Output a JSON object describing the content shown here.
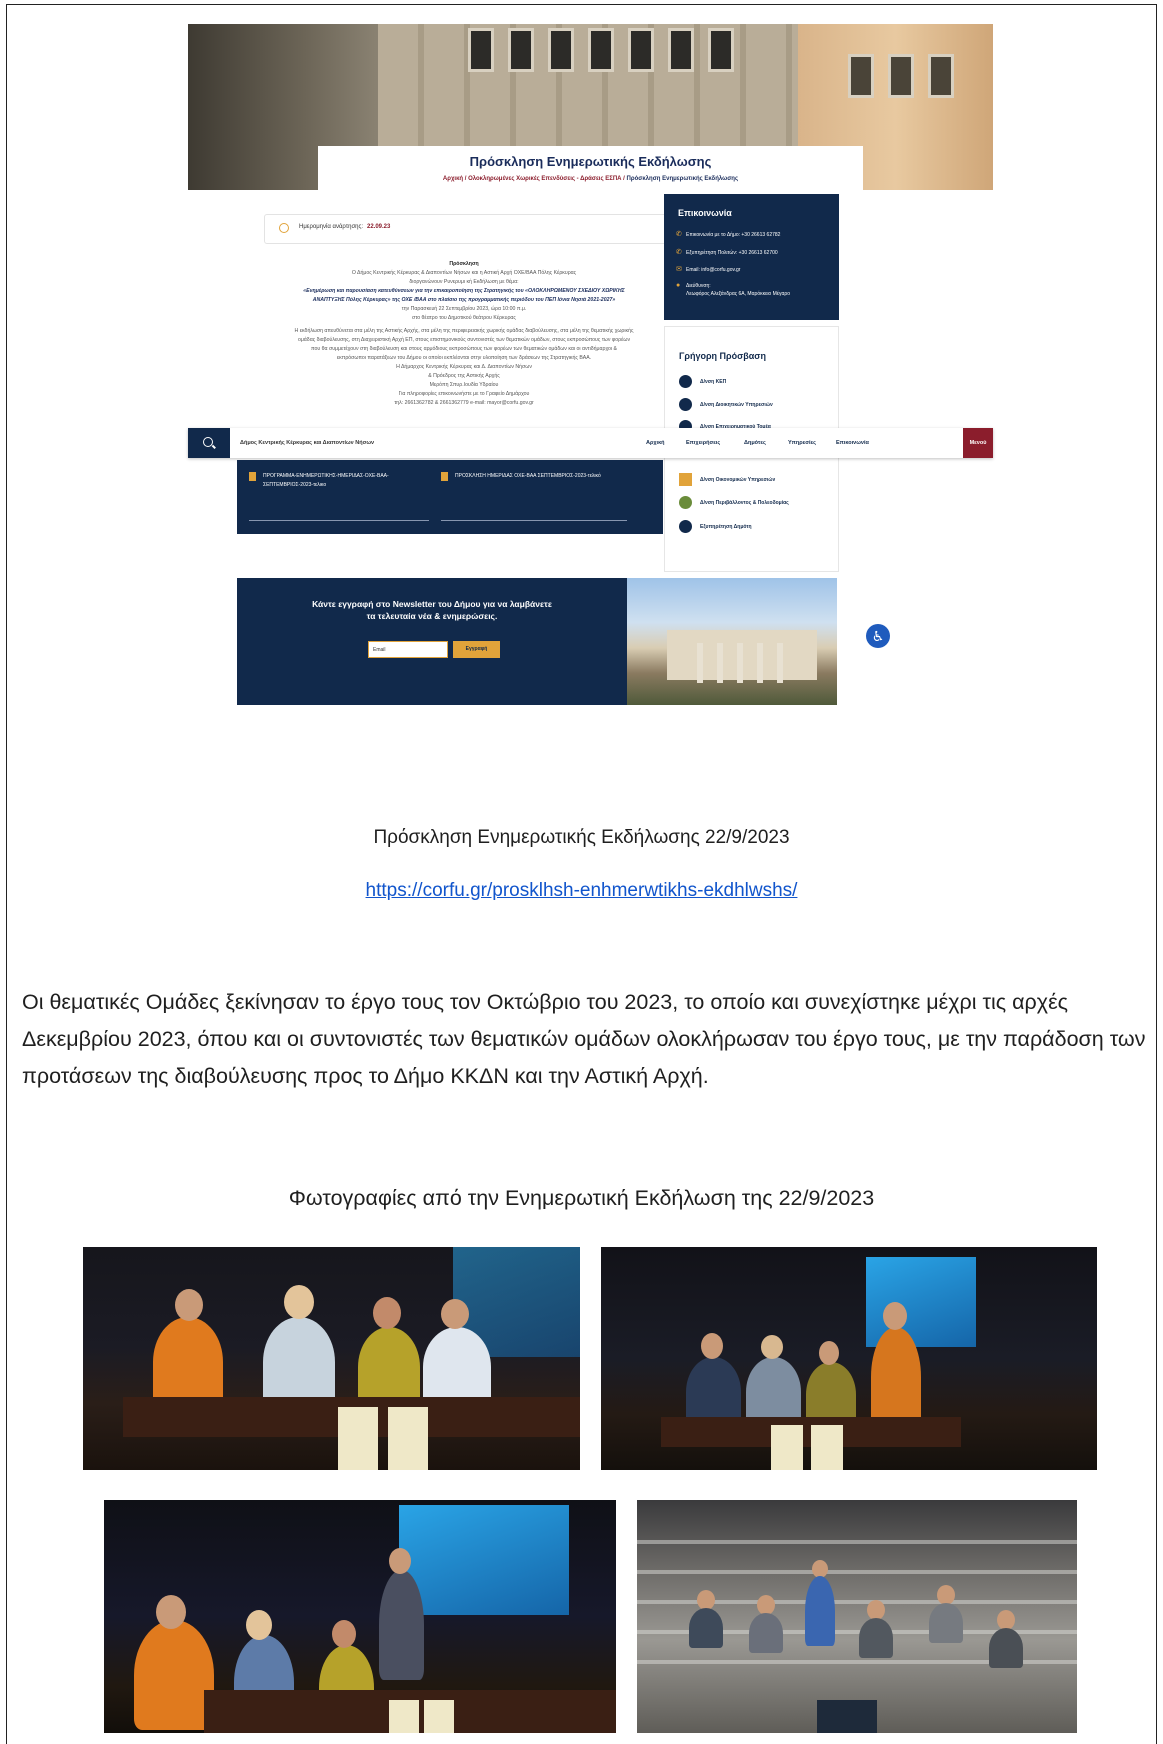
{
  "screenshot": {
    "hero_title": "Πρόσκληση Ενημερωτικής Εκδήλωσης",
    "breadcrumb_links": "Αρχική / Ολοκληρωμένες Χωρικές Επενδύσεις - Δράσεις ΕΣΠΑ /",
    "breadcrumb_current": " Πρόσκληση Ενημερωτικής Εκδήλωσης",
    "date_label": "Ημερομηνία ανάρτησης:",
    "date_value": "22.09.23",
    "body": {
      "heading": "Πρόσκληση",
      "line1": "Ο Δήμος Κεντρικής Κέρκυρας & Διαποντίων Νήσων και η Αστική Αρχή ΟΧΕ/ΒΑΑ Πόλης Κέρκυρας",
      "line2": "διοργανώνουν Ρυνερυμι κή Εκδήλωση με θέμα:",
      "topic1": "«Ενημέρωση και παρουσίαση κατευθύνσεων για την επικαιροποίηση της Στρατηγικής του «ΟΛΟΚΛΗΡΩΜΕΝΟΥ ΣΧΕΔΙΟΥ ΧΩΡΙΚΗΣ",
      "topic2": "ΑΝΑΠΤΥΞΗΣ Πόλης Κέρκυρας» της ΟΧΕ /ΒΑΑ στο πλαίσιο της προγραμματικής περιόδου του ΠΕΠ Ιόνια Νησιά 2021-2027»",
      "when": "την Παρασκευή 22 Σεπτεμβρίου 2023, ώρα 10:00 π.μ.",
      "where": "στο θέατρο του Δημοτικού θεάτρου Κέρκυρας",
      "p1": "Η εκδήλωση απευθύνεται στα μέλη της Αστικής Αρχής, στα μέλη της περιφερειακής χωρικής ομάδας διαβούλευσης, στα μέλη της θεματικής χωρικής",
      "p2": "ομάδας διαβούλευσης, στη Διαχειριστική Αρχή ΕΠ, στους επιστημονικούς συντονιστές των θεματικών ομάδων, στους εκπροσώπους των φορέων",
      "p3": "που θα συμμετέχουν στη διαβούλευση και στους αρμόδιους εκπροσώπους των φορέων των θεματικών ομάδων και οι αντιδήμαρχοι &",
      "p4": "εκπρόσωποι παρατάξεων του Δήμου οι οποίοι εκπλέονται στην υλοποίηση των δράσεων της Στρατηγικής ΒΑΑ.",
      "sig1": "Η Δήμαρχος Κεντρικής Κέρκυρας και Δ. Διαποντίων Νήσων",
      "sig2": "& Πρόεδρος της Αστικής Αρχής",
      "sig3": "Μερόπη Σπυρ.Ιουδία Υδραίου",
      "info1": "Για πληροφορίες επικοινωνήστε με το Γραφείο Δημάρχου",
      "info2": "τηλ: 2661362782 & 2661362779 e-mail: mayor@corfu.gov.gr"
    },
    "contact": {
      "title": "Επικοινωνία",
      "r1": "Επικοινωνία με το Δήμο:  +30 26613 62782",
      "r2": "Εξυπηρέτηση Πολιτών:  +30 26613 62700",
      "r3": "Email:  info@corfu.gov.gr",
      "r4a": "Διεύθυνση:",
      "r4b": "Λεωφόρος Αλεξάνδρας 6Α, Μαρόκκειο Μέγαρο"
    },
    "quick": {
      "title": "Γρήγορη Πρόσβαση",
      "i1": "Δ/νση ΚΕΠ",
      "i2": "Δ/νση Διοικητικών Υπηρεσιών",
      "i3": "Δ/νση Επιχειρηματικού Τομέα",
      "i4": "Δ/νση Οικονομικών Υπηρεσιών",
      "i5": "Δ/νση Περιβάλλοντος & Πολεοδομίας",
      "i6": "Εξυπηρέτηση Δημότη"
    },
    "nav": {
      "site": "Δήμος Κεντρικής Κέρκυρας και Διαποντίων Νήσων",
      "home": "Αρχική",
      "biz": "Επιχειρήσεις",
      "citizens": "Δημότες",
      "services": "Υπηρεσίες",
      "contact": "Επικοινωνία",
      "menu": "Μενού"
    },
    "files": {
      "f1a": "ΠΡΟΓΡΑΜΜΑ-ΕΝΗΜΕΡΩΤΙΚΗΣ-ΗΜΕΡΙΔΑΣ-ΟΧΕ-ΒΑΑ-",
      "f1b": "ΣΕΠΤΕΜΒΡΙΟΣ-2023-τελικο",
      "f2": "ΠΡΟΣΚΛΗΣΗ ΗΜΕΡΙΔΑΣ ΟΧΕ-ΒΑΑ ΣΕΠΤΕΜΒΡΙΟΣ-2023-τελικό"
    },
    "newsletter": {
      "text1": "Κάντε εγγραφή στο Newsletter του Δήμου για να λαμβάνετε",
      "text2": "τα τελευταία νέα & ενημερώσεις.",
      "email_placeholder": "Email",
      "button": "Εγγραφή"
    }
  },
  "caption": "Πρόσκληση Ενημερωτικής Εκδήλωσης 22/9/2023",
  "link": "https://corfu.gr/prosklhsh-enhmerwtikhs-ekdhlwshs/",
  "paragraph": "Οι θεματικές Ομάδες ξεκίνησαν το έργο τους τον Οκτώβριο του 2023, το οποίο και συνεχίστηκε μέχρι τις αρχές Δεκεμβρίου 2023, όπου και οι συντονιστές των θεματικών ομάδων ολοκλήρωσαν του έργο τους, με την παράδοση των προτάσεων της διαβούλευσης προς το Δήμο ΚΚΔΝ και την Αστική Αρχή.",
  "photos_caption": "Φωτογραφίες από την Ενημερωτική Εκδήλωση της 22/9/2023"
}
